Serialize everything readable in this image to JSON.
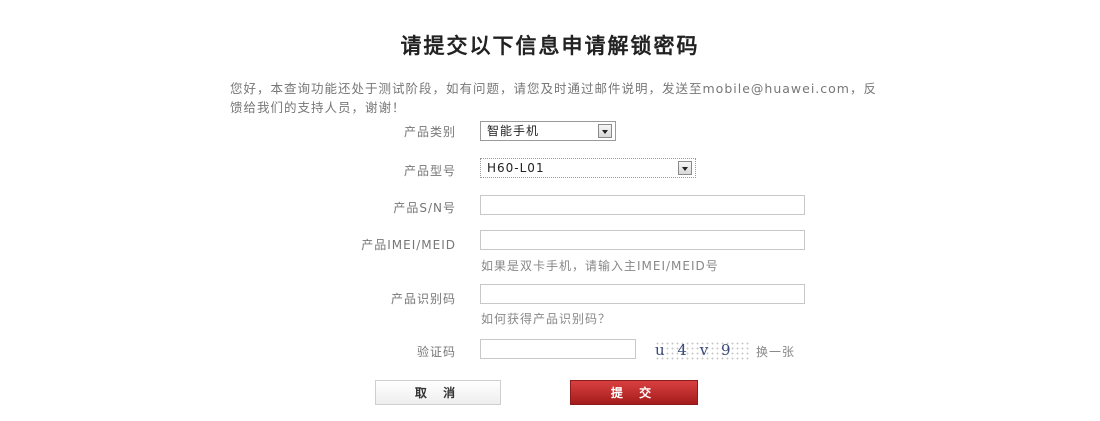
{
  "page": {
    "title": "请提交以下信息申请解锁密码",
    "intro": "您好，本查询功能还处于测试阶段，如有问题，请您及时通过邮件说明，发送至mobile@huawei.com，反馈给我们的支持人员，谢谢！"
  },
  "form": {
    "product_category": {
      "label": "产品类别",
      "value": "智能手机"
    },
    "product_model": {
      "label": "产品型号",
      "value": "H60-L01"
    },
    "serial_number": {
      "label": "产品S/N号",
      "value": ""
    },
    "imei": {
      "label": "产品IMEI/MEID",
      "value": "",
      "hint": "如果是双卡手机，请输入主IMEI/MEID号"
    },
    "product_id_code": {
      "label": "产品识别码",
      "value": "",
      "hint": "如何获得产品识别码？"
    },
    "captcha": {
      "label": "验证码",
      "value": "",
      "image_text": "u 4 v 9",
      "refresh_label": "换一张"
    }
  },
  "buttons": {
    "cancel": "取 消",
    "submit": "提 交"
  },
  "colors": {
    "submit_bg": "#b52222",
    "title_text": "#222222"
  }
}
